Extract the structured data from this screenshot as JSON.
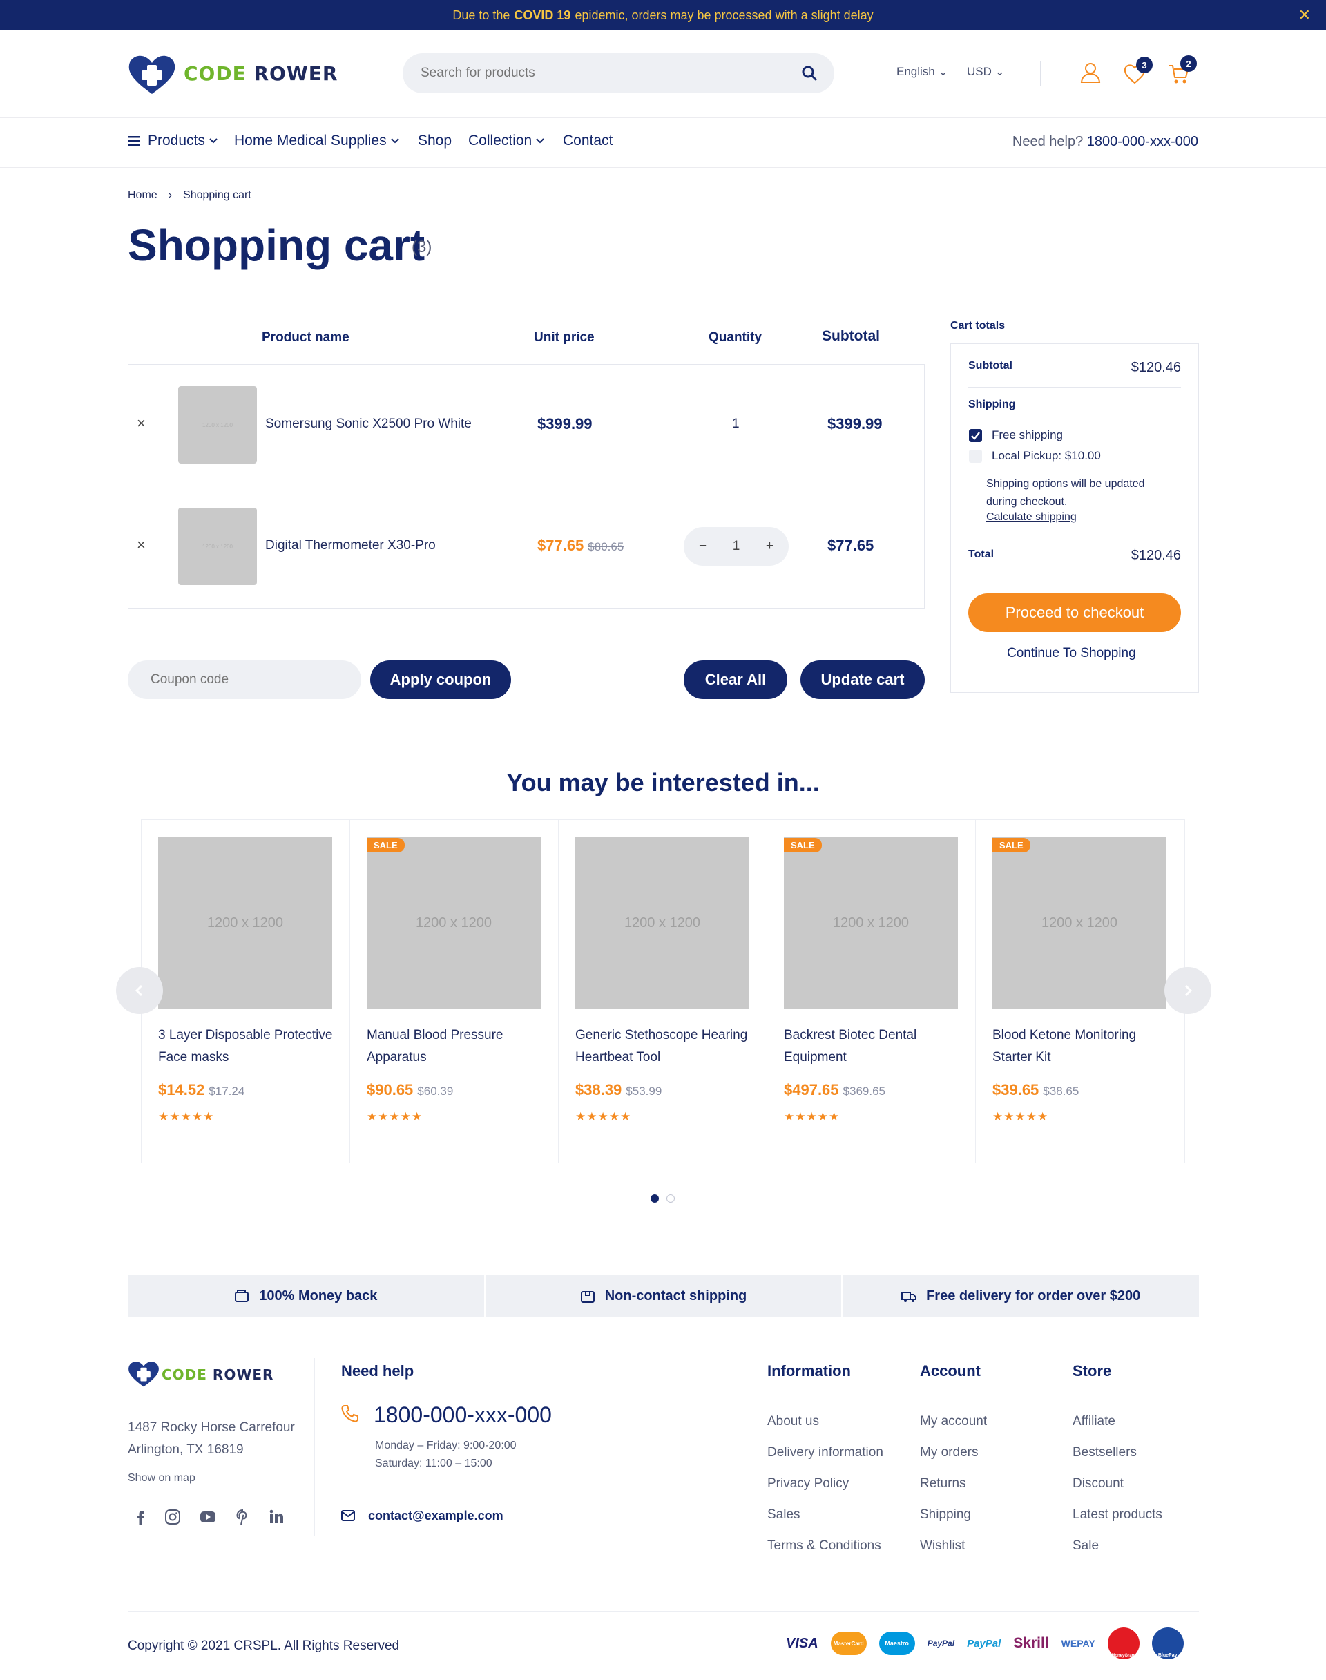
{
  "announcement": {
    "before": "Due to the",
    "highlight": "COVID 19",
    "after": "epidemic, orders may be processed with a slight delay"
  },
  "brand": {
    "code": "CODE",
    "rower": "ROWER"
  },
  "search": {
    "placeholder": "Search for products"
  },
  "header": {
    "language": "English",
    "currency": "USD",
    "wishlist_count": "3",
    "cart_count": "2"
  },
  "nav": {
    "items": [
      {
        "label": "Products"
      },
      {
        "label": "Home Medical Supplies"
      },
      {
        "label": "Shop"
      },
      {
        "label": "Collection"
      },
      {
        "label": "Contact"
      }
    ],
    "help_label": "Need help?",
    "help_phone": "1800-000-xxx-000"
  },
  "breadcrumb": {
    "home": "Home",
    "sep": "›",
    "current": "Shopping cart"
  },
  "page": {
    "title": "Shopping cart",
    "count": "(3)"
  },
  "cart_table": {
    "headers": {
      "product": "Product name",
      "unit_price": "Unit price",
      "quantity": "Quantity",
      "subtotal": "Subtotal"
    },
    "rows": [
      {
        "remove": "×",
        "thumb": "1200 x 1200",
        "name": "Somersung Sonic X2500 Pro White",
        "price": "$399.99",
        "old_price": "",
        "quantity": "1",
        "subtotal": "$399.99"
      },
      {
        "remove": "×",
        "thumb": "1200 x 1200",
        "name": "Digital Thermometer X30-Pro",
        "price": "$77.65",
        "old_price": "$80.65",
        "quantity": "1",
        "subtotal": "$77.65"
      }
    ]
  },
  "coupon": {
    "placeholder": "Coupon code",
    "apply": "Apply coupon",
    "clear": "Clear All",
    "update": "Update cart"
  },
  "totals": {
    "heading": "Cart totals",
    "subtotal_label": "Subtotal",
    "subtotal": "$120.46",
    "shipping_label": "Shipping",
    "free_shipping": "Free shipping",
    "local_pickup": "Local Pickup: $10.00",
    "shipping_note": "Shipping options will be updated during checkout.",
    "calc_shipping": "Calculate shipping",
    "total_label": "Total",
    "total": "$120.46",
    "checkout": "Proceed to checkout",
    "continue": "Continue To Shopping"
  },
  "interested": {
    "title": "You may be interested in...",
    "products": [
      {
        "image": "1200 x 1200",
        "sale": "",
        "title": "3 Layer Disposable Protective Face masks",
        "price": "$14.52",
        "old_price": "$17.24",
        "stars": "★★★★★"
      },
      {
        "image": "1200 x 1200",
        "sale": "SALE",
        "title": "Manual Blood Pressure Apparatus",
        "price": "$90.65",
        "old_price": "$60.39",
        "stars": "★★★★★"
      },
      {
        "image": "1200 x 1200",
        "sale": "",
        "title": "Generic Stethoscope Hearing Heartbeat Tool",
        "price": "$38.39",
        "old_price": "$53.99",
        "stars": "★★★★★"
      },
      {
        "image": "1200 x 1200",
        "sale": "SALE",
        "title": "Backrest Biotec Dental Equipment",
        "price": "$497.65",
        "old_price": "$369.65",
        "stars": "★★★★★"
      },
      {
        "image": "1200 x 1200",
        "sale": "SALE",
        "title": "Blood Ketone Monitoring Starter Kit",
        "price": "$39.65",
        "old_price": "$38.65",
        "stars": "★★★★★"
      }
    ]
  },
  "features": [
    {
      "label": "100% Money back"
    },
    {
      "label": "Non-contact shipping"
    },
    {
      "label": "Free delivery for order over $200"
    }
  ],
  "footer": {
    "address_line1": "1487 Rocky Horse Carrefour",
    "address_line2": "Arlington, TX 16819",
    "show_map": "Show on map",
    "help_heading": "Need help",
    "phone": "1800-000-xxx-000",
    "hours_1": "Monday – Friday: 9:00-20:00",
    "hours_2": "Saturday: 11:00 – 15:00",
    "email": "contact@example.com",
    "columns": [
      {
        "heading": "Information",
        "links": [
          "About us",
          "Delivery information",
          "Privacy Policy",
          "Sales",
          "Terms & Conditions"
        ]
      },
      {
        "heading": "Account",
        "links": [
          "My account",
          "My orders",
          "Returns",
          "Shipping",
          "Wishlist"
        ]
      },
      {
        "heading": "Store",
        "links": [
          "Affiliate",
          "Bestsellers",
          "Discount",
          "Latest products",
          "Sale"
        ]
      }
    ],
    "copyright": "Copyright © 2021 CRSPL. All Rights Reserved",
    "payments": [
      "VISA",
      "MasterCard",
      "Maestro",
      "PayPal",
      "PayPal",
      "Skrill",
      "WEPAY",
      "MoneyGram",
      "BluePay"
    ]
  },
  "colors": {
    "navy": "#13266a",
    "orange": "#f58a1f",
    "announce_highlight": "#f5c542",
    "logo_green": "#6fb52c"
  }
}
